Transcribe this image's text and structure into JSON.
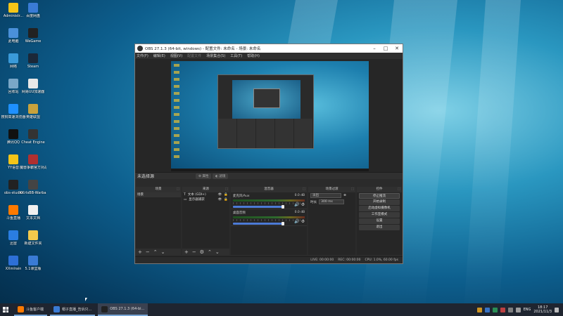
{
  "desktop": {
    "icons": [
      {
        "label": "Administr...",
        "color": "#f5c518",
        "glyph": "user-folder-icon"
      },
      {
        "label": "百度网盘",
        "color": "#3a7bd5",
        "glyph": "cloud-icon"
      },
      {
        "label": "此电脑",
        "color": "#4a90d9",
        "glyph": "computer-icon"
      },
      {
        "label": "WeGame",
        "color": "#222222",
        "glyph": "wegame-icon"
      },
      {
        "label": "网络",
        "color": "#3a9ad9",
        "glyph": "network-icon"
      },
      {
        "label": "Steam",
        "color": "#1b2838",
        "glyph": "steam-icon"
      },
      {
        "label": "回收站",
        "color": "#7aa7c7",
        "glyph": "recycle-bin-icon"
      },
      {
        "label": "网易UU加速器",
        "color": "#e8e8e8",
        "glyph": "uu-icon"
      },
      {
        "label": "搜狗高速浏览器",
        "color": "#1e90ff",
        "glyph": "browser-icon"
      },
      {
        "label": "英雄联盟",
        "color": "#c8a23c",
        "glyph": "lol-icon"
      },
      {
        "label": "腾讯QQ",
        "color": "#111111",
        "glyph": "qq-icon"
      },
      {
        "label": "Cheat Engine",
        "color": "#333333",
        "glyph": "cheat-engine-icon"
      },
      {
        "label": "YY语音",
        "color": "#f5c518",
        "glyph": "yy-icon"
      },
      {
        "label": "魔兽争霸官方对战平台",
        "color": "#b03030",
        "glyph": "warcraft-icon"
      },
      {
        "label": "obs-studio",
        "color": "#222222",
        "glyph": "obs-icon"
      },
      {
        "label": "KKrtsBB-Warband",
        "color": "#444444",
        "glyph": "warband-icon"
      },
      {
        "label": "斗鱼直播",
        "color": "#ff7a00",
        "glyph": "douyu-icon"
      },
      {
        "label": "文本文档",
        "color": "#f0f0f0",
        "glyph": "text-doc-icon"
      },
      {
        "label": "迅雷",
        "color": "#2a7de1",
        "glyph": "xunlei-icon"
      },
      {
        "label": "新建文件夹",
        "color": "#f2c94c",
        "glyph": "folder-icon"
      },
      {
        "label": "XXmlrain",
        "color": "#2d6fd6",
        "glyph": "app-icon"
      },
      {
        "label": "5.1课堂版",
        "color": "#3a7bd5",
        "glyph": "app-icon"
      }
    ]
  },
  "obs": {
    "title": "OBS 27.1.3 (64-bit, windows) - 配置文件: 未命名 - 场景: 未命名",
    "menu": [
      "文件(F)",
      "编辑(E)",
      "视图(V)",
      "配置文件",
      "场景集合(S)",
      "工具(T)",
      "帮助(H)"
    ],
    "menu_disabled": [
      false,
      false,
      false,
      true,
      false,
      false,
      false
    ],
    "scene_header": "未选择源",
    "props_button": "属性",
    "filters_button": "滤镜",
    "docks": {
      "scenes": {
        "title": "场景",
        "items": [
          "场景"
        ]
      },
      "sources": {
        "title": "来源",
        "items": [
          {
            "name": "文本 (GDI+)",
            "icon": "text-source-icon"
          },
          {
            "name": "显示器捕获",
            "icon": "monitor-source-icon"
          }
        ]
      },
      "mixer": {
        "title": "混音器",
        "channels": [
          {
            "name": "麦克风/Aux",
            "db": "0.0 dB"
          },
          {
            "name": "桌面音频",
            "db": "0.0 dB"
          }
        ]
      },
      "transitions": {
        "title": "场景过渡",
        "type": "淡出",
        "duration_label": "时长",
        "duration": "300 ms"
      },
      "controls": {
        "title": "控件",
        "buttons": [
          "停止推流",
          "开始录制",
          "启动虚拟摄像机",
          "工作室模式",
          "设置",
          "退出"
        ]
      }
    },
    "status": {
      "live": "LIVE: 00:00:00",
      "rec": "REC: 00:00:00",
      "cpu": "CPU: 1.0%, 60.00 fps"
    }
  },
  "taskbar": {
    "apps": [
      {
        "label": "斗鱼客户端",
        "color": "#ff7a00",
        "active": false
      },
      {
        "label": "帽子直播_告诉只...",
        "color": "#3a7bd5",
        "active": false
      },
      {
        "label": "OBS 27.1.3 (64-bi...",
        "color": "#222222",
        "active": true
      }
    ],
    "lang": "ENG",
    "time": "18:17",
    "date": "2021/11/3"
  },
  "colors": {
    "accent": "#4d7bd6",
    "desktop_bg": "#0d5f8e",
    "obs_bg": "#2b2b2b"
  }
}
